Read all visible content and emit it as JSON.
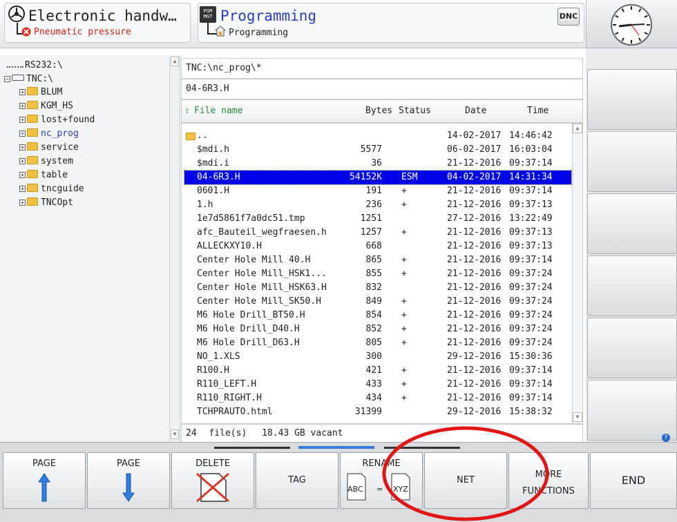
{
  "header": {
    "op_mode_title": "Electronic handw…",
    "op_mode_alarm": "Pneumatic pressure",
    "prog_mode_title": "Programming",
    "prog_mode_sub": "Programming",
    "pgm_badge": "PGM\nMGT",
    "dnc_badge": "DNC"
  },
  "tree": {
    "items": [
      {
        "label": "RS232:\\"
      },
      {
        "label": "TNC:\\"
      },
      {
        "label": "BLUM"
      },
      {
        "label": "KGM_HS"
      },
      {
        "label": "lost+found"
      },
      {
        "label": "nc_prog"
      },
      {
        "label": "service"
      },
      {
        "label": "system"
      },
      {
        "label": "table"
      },
      {
        "label": "tncguide"
      },
      {
        "label": "TNCOpt"
      }
    ]
  },
  "file_panel": {
    "path": "TNC:\\nc_prog\\*",
    "filename": "04-6R3.H",
    "columns": {
      "name": "File name",
      "bytes": "Bytes",
      "status": "Status",
      "date": "Date",
      "time": "Time"
    },
    "rows": [
      {
        "name": "..",
        "bytes": "",
        "status": "",
        "date": "14-02-2017",
        "time": "14:46:42"
      },
      {
        "name": "$mdi.h",
        "bytes": "5577",
        "status": "",
        "date": "06-02-2017",
        "time": "16:03:04"
      },
      {
        "name": "$mdi.i",
        "bytes": "36",
        "status": "",
        "date": "21-12-2016",
        "time": "09:37:14"
      },
      {
        "name": "04-6R3.H",
        "bytes": "54152K",
        "status": "ESM",
        "date": "04-02-2017",
        "time": "14:31:34"
      },
      {
        "name": "0601.H",
        "bytes": "191",
        "status": "+",
        "date": "21-12-2016",
        "time": "09:37:14"
      },
      {
        "name": "1.h",
        "bytes": "236",
        "status": "+",
        "date": "21-12-2016",
        "time": "09:37:13"
      },
      {
        "name": "1e7d5861f7a0dc51.tmp",
        "bytes": "1251",
        "status": "",
        "date": "27-12-2016",
        "time": "13:22:49"
      },
      {
        "name": "afc_Bauteil_wegfraesen.h",
        "bytes": "1257",
        "status": "+",
        "date": "21-12-2016",
        "time": "09:37:13"
      },
      {
        "name": "ALLECKXY10.H",
        "bytes": "668",
        "status": "",
        "date": "21-12-2016",
        "time": "09:37:13"
      },
      {
        "name": "Center Hole Mill 40.H",
        "bytes": "865",
        "status": "+",
        "date": "21-12-2016",
        "time": "09:37:14"
      },
      {
        "name": "Center Hole Mill_HSK1...",
        "bytes": "855",
        "status": "+",
        "date": "21-12-2016",
        "time": "09:37:24"
      },
      {
        "name": "Center Hole Mill_HSK63.H",
        "bytes": "832",
        "status": "",
        "date": "21-12-2016",
        "time": "09:37:24"
      },
      {
        "name": "Center Hole Mill_SK50.H",
        "bytes": "849",
        "status": "+",
        "date": "21-12-2016",
        "time": "09:37:24"
      },
      {
        "name": "M6 Hole Drill_BT50.H",
        "bytes": "854",
        "status": "+",
        "date": "21-12-2016",
        "time": "09:37:24"
      },
      {
        "name": "M6 Hole Drill_D40.H",
        "bytes": "852",
        "status": "+",
        "date": "21-12-2016",
        "time": "09:37:24"
      },
      {
        "name": "M6 Hole Drill_D63.H",
        "bytes": "805",
        "status": "+",
        "date": "21-12-2016",
        "time": "09:37:24"
      },
      {
        "name": "NO_1.XLS",
        "bytes": "300",
        "status": "",
        "date": "29-12-2016",
        "time": "15:30:36"
      },
      {
        "name": "R100.H",
        "bytes": "421",
        "status": "+",
        "date": "21-12-2016",
        "time": "09:37:14"
      },
      {
        "name": "R110_LEFT.H",
        "bytes": "433",
        "status": "+",
        "date": "21-12-2016",
        "time": "09:37:14"
      },
      {
        "name": "R110_RIGHT.H",
        "bytes": "434",
        "status": "+",
        "date": "21-12-2016",
        "time": "09:37:14"
      },
      {
        "name": "TCHPRAUTO.html",
        "bytes": "31399",
        "status": "",
        "date": "29-12-2016",
        "time": "15:38:32"
      }
    ],
    "status_count": "24",
    "status_files": "file(s)",
    "status_free": "18.43 GB vacant"
  },
  "softkeys": {
    "page_up": "PAGE",
    "page_down": "PAGE",
    "delete": "DELETE",
    "tag": "TAG",
    "rename": "RENAME",
    "rename_abc": "ABC",
    "rename_eq": "=",
    "rename_xyz": "XYZ",
    "net": "NET",
    "more_1": "MORE",
    "more_2": "FUNCTIONS",
    "end": "END"
  },
  "colors": {
    "selection": "#0000e6",
    "accent_blue": "#2a3fb8",
    "annotation_red": "#e01515"
  }
}
